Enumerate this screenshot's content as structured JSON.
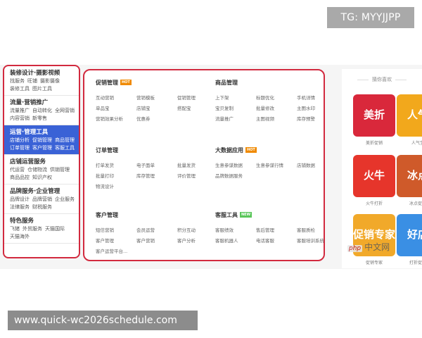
{
  "badge": "TG: MYYJJPP",
  "sidebar": [
    {
      "title": "装修设计·摄影视频",
      "rows": [
        [
          "找服务",
          "旺铺",
          "摄影摄像"
        ],
        [
          "装修工具",
          "图片工具"
        ]
      ],
      "active": false
    },
    {
      "title": "流量·营销推广",
      "rows": [
        [
          "流量推广",
          "自动转化",
          "全网营销"
        ],
        [
          "内容营销",
          "新零售"
        ]
      ],
      "active": false
    },
    {
      "title": "运营·管理工具",
      "rows": [
        [
          "店铺分析",
          "促销管理",
          "商品管理"
        ],
        [
          "订单管理",
          "客户管理",
          "客服工具"
        ]
      ],
      "active": true
    },
    {
      "title": "店铺运营服务",
      "rows": [
        [
          "代运营",
          "仓储物流",
          "供销管理"
        ],
        [
          "商品品控",
          "知识产权"
        ]
      ],
      "active": false
    },
    {
      "title": "品牌服务·企业管理",
      "rows": [
        [
          "品牌设计",
          "品牌营销",
          "企业服务"
        ],
        [
          "法律服务",
          "财税服务"
        ]
      ],
      "active": false
    },
    {
      "title": "特色服务",
      "rows": [
        [
          "飞猪",
          "外贸服务",
          "天猫国际"
        ],
        [
          "天猫海外"
        ]
      ],
      "active": false
    }
  ],
  "sections": {
    "promo": {
      "title": "促销管理",
      "tag": "HOT",
      "items": [
        "互动营销",
        "营销模板",
        "促销管理",
        "单品宝",
        "店铺宝",
        "搭配宝",
        "营销效果分析",
        "优惠券"
      ]
    },
    "product": {
      "title": "商品管理",
      "items": [
        "上下架",
        "标题优化",
        "手机详情",
        "宝贝复制",
        "批量修改",
        "主图水印",
        "流量推广",
        "主图视频",
        "库存预警"
      ]
    },
    "order": {
      "title": "订单管理",
      "items": [
        "打单发货",
        "电子面单",
        "批量发货",
        "批量打印",
        "库存管理",
        "评价管理",
        "物流设计"
      ]
    },
    "bigdata": {
      "title": "大数据应用",
      "tag": "HOT",
      "items": [
        "生意参谋数据",
        "生意参谋行情",
        "店铺数据",
        "品牌数据服务"
      ]
    },
    "customer": {
      "title": "客户管理",
      "items": [
        "短信营销",
        "会员运营",
        "积分互动",
        "客户管理",
        "客户营销",
        "客户分析",
        "客户运营平台..."
      ]
    },
    "service": {
      "title": "客服工具",
      "tag": "NEW",
      "items": [
        "客服绩效",
        "售后管理",
        "客服质检",
        "客服机器人",
        "电话客服",
        "客服培训系统"
      ]
    }
  },
  "recommend": {
    "title": "猜你喜欢",
    "tiles": [
      {
        "text": "美折",
        "label": "美折促销",
        "color": "#d9283b"
      },
      {
        "text": "人气",
        "label": "人气宝",
        "color": "#f2a81c"
      },
      {
        "text": "火牛",
        "label": "火牛打折",
        "color": "#e6352b"
      },
      {
        "text": "冰点",
        "label": "冰点促销",
        "color": "#cf5a2a"
      },
      {
        "text": "促销专家",
        "label": "促销专家",
        "color": "#f1a92a"
      },
      {
        "text": "好店",
        "label": "打折促销",
        "color": "#3a8fe4"
      }
    ]
  },
  "watermark": {
    "php": "php",
    "text": "中文网"
  },
  "url": "www.quick-wc2026schedule.com"
}
